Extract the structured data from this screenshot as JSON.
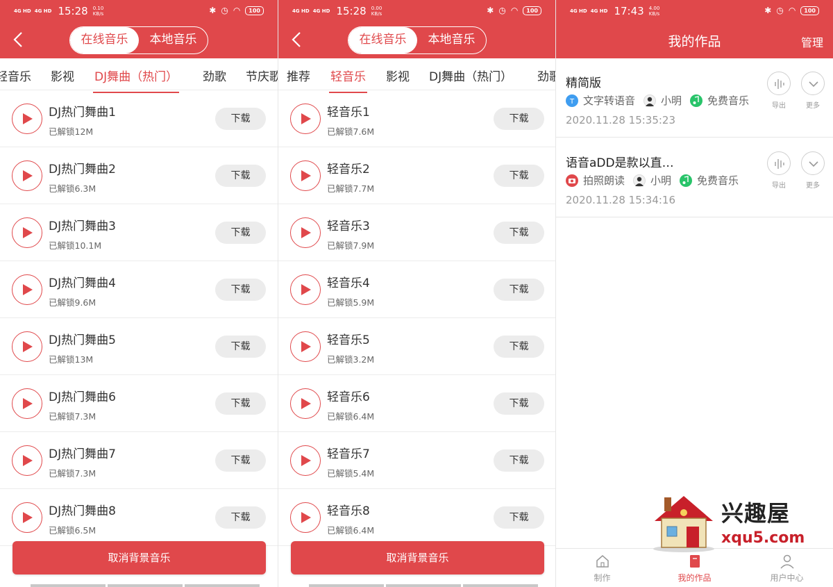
{
  "screens": [
    {
      "status": {
        "signal1": "4G HD",
        "signal2": "4G HD",
        "time": "15:28",
        "speed_value": "0.10",
        "speed_unit": "KB/s",
        "battery": "100"
      },
      "segment": {
        "online": "在线音乐",
        "local": "本地音乐",
        "active": "online"
      },
      "tabs": [
        "轻音乐",
        "影视",
        "DJ舞曲（热门）",
        "劲歌",
        "节庆歌"
      ],
      "active_tab": "DJ舞曲（热门）",
      "download_label": "下载",
      "items": [
        {
          "title": "DJ热门舞曲1",
          "sub": "已解锁12M"
        },
        {
          "title": "DJ热门舞曲2",
          "sub": "已解锁6.3M"
        },
        {
          "title": "DJ热门舞曲3",
          "sub": "已解锁10.1M"
        },
        {
          "title": "DJ热门舞曲4",
          "sub": "已解锁9.6M"
        },
        {
          "title": "DJ热门舞曲5",
          "sub": "已解锁13M"
        },
        {
          "title": "DJ热门舞曲6",
          "sub": "已解锁7.3M"
        },
        {
          "title": "DJ热门舞曲7",
          "sub": "已解锁7.3M"
        },
        {
          "title": "DJ热门舞曲8",
          "sub": "已解锁6.5M"
        }
      ],
      "cancel_label": "取消背景音乐"
    },
    {
      "status": {
        "signal1": "4G HD",
        "signal2": "4G HD",
        "time": "15:28",
        "speed_value": "0.00",
        "speed_unit": "KB/s",
        "battery": "100"
      },
      "segment": {
        "online": "在线音乐",
        "local": "本地音乐",
        "active": "online"
      },
      "tabs": [
        "推荐",
        "轻音乐",
        "影视",
        "DJ舞曲（热门）",
        "劲歌"
      ],
      "active_tab": "轻音乐",
      "download_label": "下载",
      "items": [
        {
          "title": "轻音乐1",
          "sub": "已解锁7.6M"
        },
        {
          "title": "轻音乐2",
          "sub": "已解锁7.7M"
        },
        {
          "title": "轻音乐3",
          "sub": "已解锁7.9M"
        },
        {
          "title": "轻音乐4",
          "sub": "已解锁5.9M"
        },
        {
          "title": "轻音乐5",
          "sub": "已解锁3.2M"
        },
        {
          "title": "轻音乐6",
          "sub": "已解锁6.4M"
        },
        {
          "title": "轻音乐7",
          "sub": "已解锁5.4M"
        },
        {
          "title": "轻音乐8",
          "sub": "已解锁6.4M"
        }
      ],
      "cancel_label": "取消背景音乐"
    }
  ],
  "works_screen": {
    "status": {
      "signal1": "4G HD",
      "signal2": "4G HD",
      "time": "17:43",
      "speed_value": "4.00",
      "speed_unit": "KB/s",
      "battery": "100"
    },
    "title": "我的作品",
    "manage": "管理",
    "export_label": "导出",
    "more_label": "更多",
    "works": [
      {
        "title": "精简版",
        "tags": [
          {
            "icon": "text-to-speech-icon",
            "label": "文字转语音",
            "color": "#3f9df0"
          },
          {
            "icon": "avatar-icon",
            "label": "小明",
            "color": "#f0f0f0"
          },
          {
            "icon": "music-note-icon",
            "label": "免费音乐",
            "color": "#29c46a"
          }
        ],
        "date": "2020.11.28 15:35:23"
      },
      {
        "title": "语音aDD是款以直…",
        "tags": [
          {
            "icon": "camera-icon",
            "label": "拍照朗读",
            "color": "#e0484b"
          },
          {
            "icon": "avatar-icon",
            "label": "小明",
            "color": "#f0f0f0"
          },
          {
            "icon": "music-note-icon",
            "label": "免费音乐",
            "color": "#29c46a"
          }
        ],
        "date": "2020.11.28 15:34:16"
      }
    ],
    "tabbar": [
      {
        "label": "制作",
        "icon": "house-icon",
        "active": false
      },
      {
        "label": "我的作品",
        "icon": "book-icon",
        "active": true
      },
      {
        "label": "用户中心",
        "icon": "user-icon",
        "active": false
      }
    ]
  },
  "watermark": {
    "cn": "兴趣屋",
    "url": "xqu5.com"
  },
  "colors": {
    "accent": "#e0484b",
    "divider": "#ececec",
    "button_gray": "#ececec"
  }
}
